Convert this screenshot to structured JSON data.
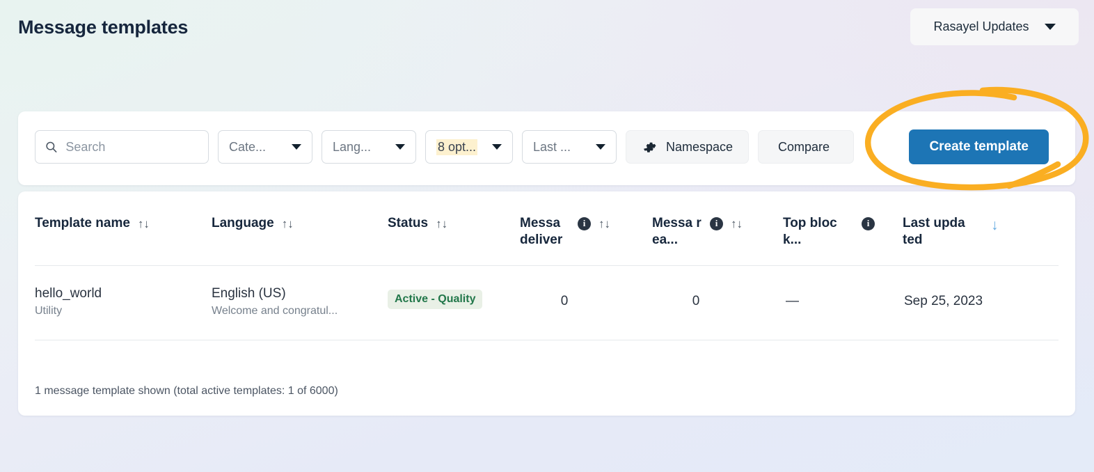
{
  "header": {
    "title": "Message templates",
    "account_switcher": {
      "label": "Rasayel Updates",
      "caret_icon": "chevron-down-icon"
    }
  },
  "filters": {
    "search": {
      "placeholder": "Search",
      "value": "",
      "icon": "search-icon"
    },
    "category": {
      "label": "Cate...",
      "caret_icon": "chevron-down-icon"
    },
    "language": {
      "label": "Lang...",
      "caret_icon": "chevron-down-icon"
    },
    "options": {
      "label": "8 opt...",
      "caret_icon": "chevron-down-icon",
      "highlighted": true
    },
    "last": {
      "label": "Last ...",
      "caret_icon": "chevron-down-icon"
    },
    "namespace": {
      "label": "Namespace",
      "icon": "gear-icon"
    },
    "compare": {
      "label": "Compare"
    },
    "create": {
      "label": "Create template"
    }
  },
  "table": {
    "columns": [
      {
        "label": "Template name",
        "sort_icon": "sort-updown-icon",
        "info_icon": false
      },
      {
        "label": "Language",
        "sort_icon": "sort-updown-icon",
        "info_icon": false
      },
      {
        "label": "Status",
        "sort_icon": "sort-updown-icon",
        "info_icon": false
      },
      {
        "label": "Messa deliver",
        "sort_icon": "sort-updown-icon",
        "info_icon": true
      },
      {
        "label": "Messa rea...",
        "sort_icon": "sort-updown-icon",
        "info_icon": true
      },
      {
        "label": "Top block...",
        "sort_icon": "",
        "info_icon": true
      },
      {
        "label": "Last updated",
        "sort_icon": "sort-down-icon",
        "info_icon": false,
        "sort_active": true
      }
    ],
    "sort_glyph": "↑↓",
    "sort_active_glyph": "↓",
    "rows": [
      {
        "name": "hello_world",
        "category": "Utility",
        "language": "English (US)",
        "language_sub": "Welcome and congratul...",
        "status": "Active - Quality",
        "messages_delivered": "0",
        "messages_read": "0",
        "top_block_reason": "—",
        "last_updated": "Sep 25, 2023"
      }
    ],
    "footnote": "1 message template shown (total active templates: 1 of 6000)"
  },
  "annotation": {
    "shape": "hand-drawn-ellipse",
    "color": "#FAAE22",
    "target": "Create template"
  },
  "colors": {
    "primary_button": "#1D75B5",
    "annotation": "#FAAE22",
    "badge_bg": "#E9F0E6",
    "badge_text": "#22774A",
    "highlight": "#FDF1CF"
  }
}
